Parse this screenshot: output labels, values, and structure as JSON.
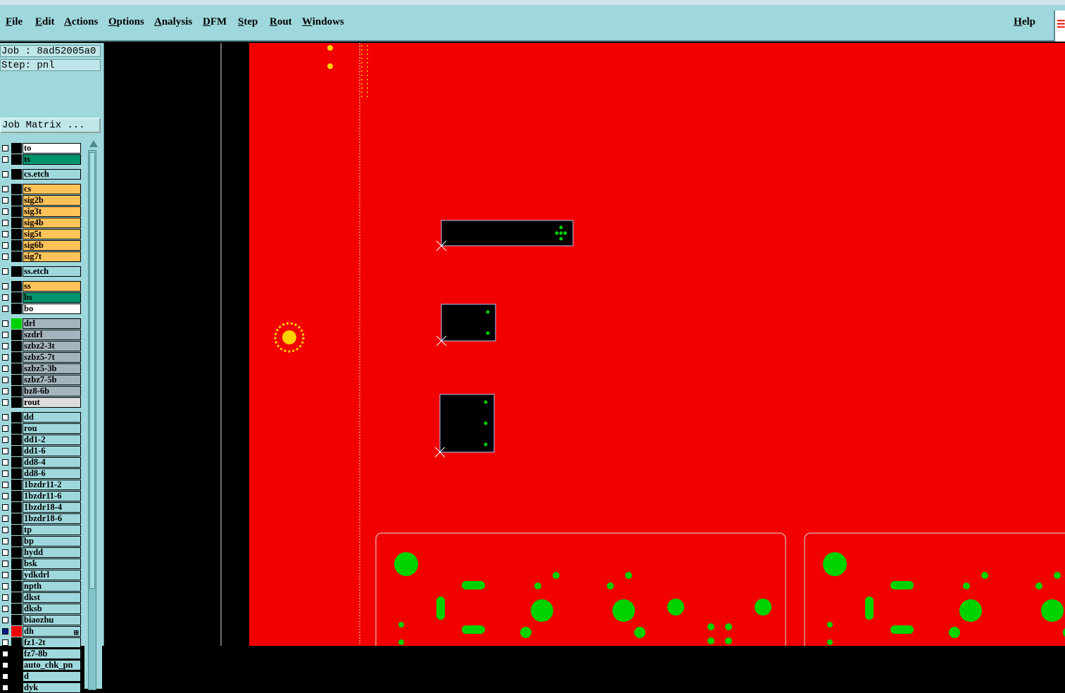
{
  "menu": {
    "file": "File",
    "edit": "Edit",
    "actions": "Actions",
    "options": "Options",
    "analysis": "Analysis",
    "dfm": "DFM",
    "step": "Step",
    "rout": "Rout",
    "windows": "Windows",
    "help": "Help"
  },
  "info": {
    "job": "Job : 8ad52005a0",
    "step": "Step: pnl",
    "job_matrix": "Job Matrix ..."
  },
  "colors": {
    "board": "#f20000",
    "signal": "#ffc35a",
    "drill": "#a4b4bc",
    "misc": "#9fd8dc",
    "mask": "#00946e",
    "feature": "#00d200",
    "marker": "#ffd200"
  },
  "layers": [
    {
      "name": "to",
      "color": "#ffffff"
    },
    {
      "name": "ts",
      "color": "#00946e"
    },
    {
      "name": "cs.etch",
      "color": "#9fd8dc"
    },
    {
      "name": "cs",
      "color": "#ffc35a"
    },
    {
      "name": "sig2b",
      "color": "#ffc35a"
    },
    {
      "name": "sig3t",
      "color": "#ffc35a"
    },
    {
      "name": "sig4b",
      "color": "#ffc35a"
    },
    {
      "name": "sig5t",
      "color": "#ffc35a"
    },
    {
      "name": "sig6b",
      "color": "#ffc35a"
    },
    {
      "name": "sig7t",
      "color": "#ffc35a"
    },
    {
      "name": "ss.etch",
      "color": "#9fd8dc"
    },
    {
      "name": "ss",
      "color": "#ffc35a"
    },
    {
      "name": "bs",
      "color": "#00946e"
    },
    {
      "name": "bo",
      "color": "#ffffff"
    },
    {
      "name": "drl",
      "color": "#a4b4bc",
      "swatch": "#00d200"
    },
    {
      "name": "szdrl",
      "color": "#a4b4bc"
    },
    {
      "name": "szbz2-3t",
      "color": "#a4b4bc"
    },
    {
      "name": "szbz5-7t",
      "color": "#a4b4bc"
    },
    {
      "name": "szbz5-3b",
      "color": "#a4b4bc"
    },
    {
      "name": "szbz7-5b",
      "color": "#a4b4bc"
    },
    {
      "name": "bz8-6b",
      "color": "#a4b4bc"
    },
    {
      "name": "rout",
      "color": "#dcdcdc"
    },
    {
      "name": "dd",
      "color": "#9fd8dc"
    },
    {
      "name": "rou",
      "color": "#9fd8dc"
    },
    {
      "name": "dd1-2",
      "color": "#9fd8dc"
    },
    {
      "name": "dd1-6",
      "color": "#9fd8dc"
    },
    {
      "name": "dd8-4",
      "color": "#9fd8dc"
    },
    {
      "name": "dd8-6",
      "color": "#9fd8dc"
    },
    {
      "name": "1bzdr11-2",
      "color": "#9fd8dc"
    },
    {
      "name": "1bzdr11-6",
      "color": "#9fd8dc"
    },
    {
      "name": "1bzdr18-4",
      "color": "#9fd8dc"
    },
    {
      "name": "1bzdr18-6",
      "color": "#9fd8dc"
    },
    {
      "name": "tp",
      "color": "#9fd8dc"
    },
    {
      "name": "bp",
      "color": "#9fd8dc"
    },
    {
      "name": "hydd",
      "color": "#9fd8dc"
    },
    {
      "name": "bsk",
      "color": "#9fd8dc"
    },
    {
      "name": "ydkdrl",
      "color": "#9fd8dc"
    },
    {
      "name": "npth",
      "color": "#9fd8dc"
    },
    {
      "name": "dkst",
      "color": "#9fd8dc"
    },
    {
      "name": "dksb",
      "color": "#9fd8dc"
    },
    {
      "name": "biaozhu",
      "color": "#9fd8dc"
    },
    {
      "name": "dh",
      "color": "#9fd8dc",
      "swatch": "#f20000",
      "selected": true,
      "tick": "⊞"
    },
    {
      "name": "fz1-2t",
      "color": "#9fd8dc"
    },
    {
      "name": "fz7-8b",
      "color": "#9fd8dc"
    },
    {
      "name": "auto_chk_pn",
      "color": "#9fd8dc"
    },
    {
      "name": "d",
      "color": "#9fd8dc"
    },
    {
      "name": "dyk",
      "color": "#9fd8dc"
    }
  ]
}
